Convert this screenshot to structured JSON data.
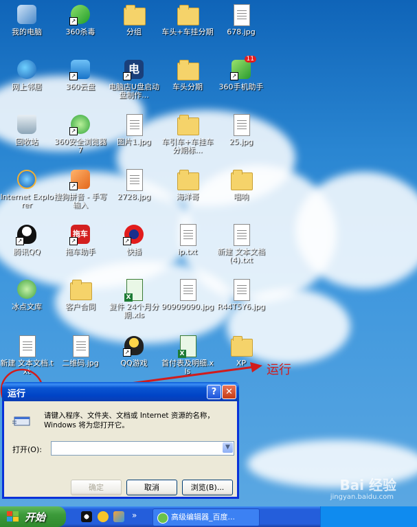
{
  "desktop": {
    "icons": [
      {
        "label": "我的电脑"
      },
      {
        "label": "360杀毒"
      },
      {
        "label": "分组"
      },
      {
        "label": "车头+车挂分期"
      },
      {
        "label": "678.jpg"
      },
      {
        "label": "网上邻居"
      },
      {
        "label": "360云盘"
      },
      {
        "label": "电脑店U盘启动盘制作..."
      },
      {
        "label": "车头分期"
      },
      {
        "label": "360手机助手"
      },
      {
        "label": "回收站"
      },
      {
        "label": "360安全浏览器7"
      },
      {
        "label": "图片1.jpg"
      },
      {
        "label": "车引车+车挂车分期标..."
      },
      {
        "label": "25.jpg"
      },
      {
        "label": "Internet Explorer"
      },
      {
        "label": "搜狗拼音 - 手写输入"
      },
      {
        "label": "2728.jpg"
      },
      {
        "label": "海洋哥"
      },
      {
        "label": "唱响"
      },
      {
        "label": "腾讯QQ"
      },
      {
        "label": "拖车助手"
      },
      {
        "label": "快播"
      },
      {
        "label": "ip.txt"
      },
      {
        "label": "新建 文本文档 (4).txt"
      },
      {
        "label": "冰点文库"
      },
      {
        "label": "客户合同"
      },
      {
        "label": "复件 24个月分期.xls"
      },
      {
        "label": "90909090.jpg"
      },
      {
        "label": "R44T5Y6.jpg"
      },
      {
        "label": "新建 文本文档.txt"
      },
      {
        "label": "二维码.jpg"
      },
      {
        "label": "QQ游戏"
      },
      {
        "label": "首付表及明细.xls"
      },
      {
        "label": "XP"
      }
    ],
    "badge_360_phone": "11",
    "icon_tiles": {
      "tuoche": "拖车",
      "dian": "电"
    }
  },
  "annotation": {
    "run_label": "运行"
  },
  "dialog": {
    "title": "运行",
    "help_glyph": "?",
    "close_glyph": "✕",
    "description": "请键入程序、文件夹、文档或 Internet 资源的名称，Windows 将为您打开它。",
    "open_label": "打开(O):",
    "open_value": "",
    "ok_label": "确定",
    "cancel_label": "取消",
    "browse_label": "浏览(B)..."
  },
  "taskbar": {
    "start_label": "开始",
    "chevron": "»",
    "task_label": "高级编辑器_百度..."
  },
  "watermark": {
    "brand": "Bai 经验",
    "url": "jingyan.baidu.com"
  },
  "colors": {
    "dialog_title": "#0a55d2",
    "taskbar": "#245edb",
    "start": "#3c9a3a",
    "annotation": "#d11c1c"
  }
}
